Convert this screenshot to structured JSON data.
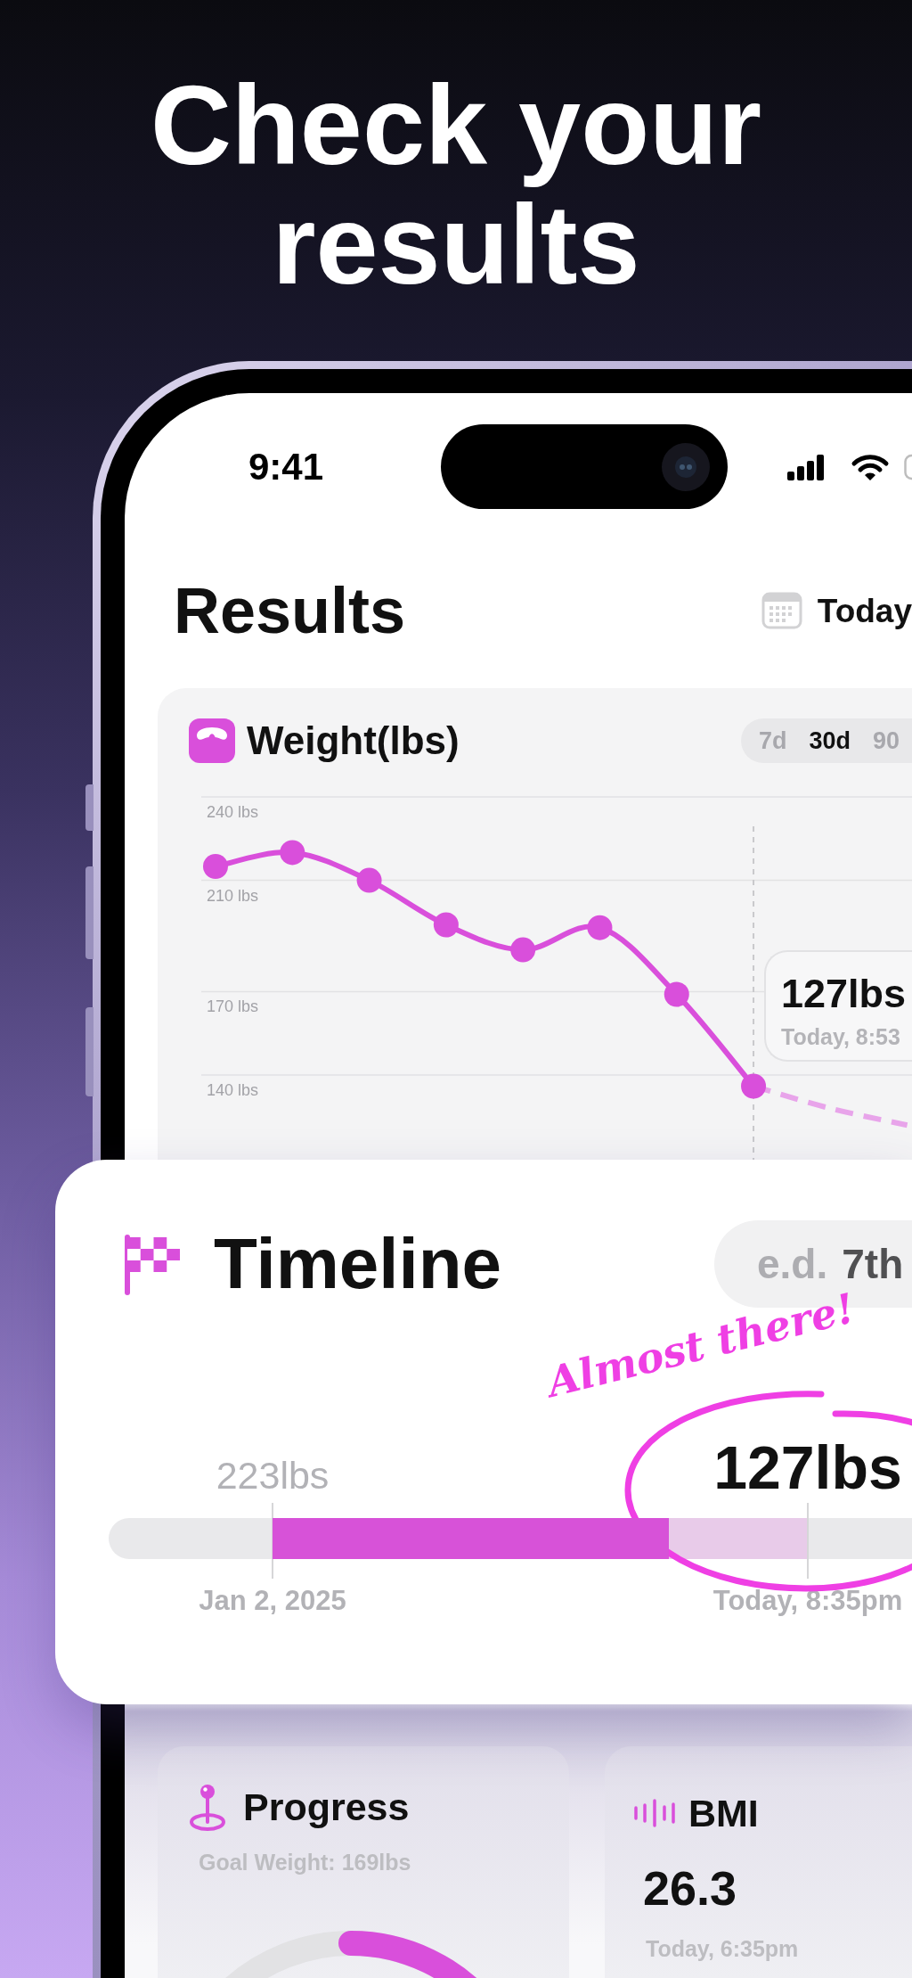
{
  "headline": "Check your results",
  "status_bar": {
    "time": "9:41"
  },
  "header": {
    "title": "Results",
    "date_button": "Today"
  },
  "weight_card": {
    "title": "Weight(lbs)",
    "ranges": [
      {
        "label": "7d",
        "selected": false
      },
      {
        "label": "30d",
        "selected": true
      },
      {
        "label": "90",
        "selected": false
      }
    ],
    "chart_data": {
      "type": "line",
      "grid": true,
      "ylim": [
        100,
        240
      ],
      "yticks": [
        {
          "value": 240,
          "label": "240 lbs"
        },
        {
          "value": 210,
          "label": "210 lbs"
        },
        {
          "value": 170,
          "label": "170 lbs"
        },
        {
          "value": 140,
          "label": "140 lbs"
        }
      ],
      "series": [
        {
          "color": "#d94fdb",
          "line_style": "solid",
          "marker": "circle",
          "values": [
            215,
            220,
            210,
            194,
            185,
            193,
            169,
            136
          ]
        },
        {
          "color": "#e8a4ea",
          "line_style": "dashed",
          "values": [
            null,
            null,
            null,
            null,
            null,
            null,
            null,
            136,
            128,
            122
          ]
        }
      ]
    },
    "tooltip": {
      "value": "127lbs",
      "time": "Today, 8:53"
    }
  },
  "timeline_card": {
    "title": "Timeline",
    "estimate": {
      "label": "e.d.",
      "value": "7th"
    },
    "note": "Almost there!",
    "start": {
      "weight": "223lbs",
      "date": "Jan 2, 2025"
    },
    "current": {
      "weight": "127lbs",
      "date": "Today, 8:35pm"
    },
    "level": 0.74
  },
  "progress_card": {
    "title": "Progress",
    "subtitle": "Goal Weight: 169lbs"
  },
  "bmi_card": {
    "title": "BMI",
    "value": "26.3",
    "time": "Today, 6:35pm"
  }
}
